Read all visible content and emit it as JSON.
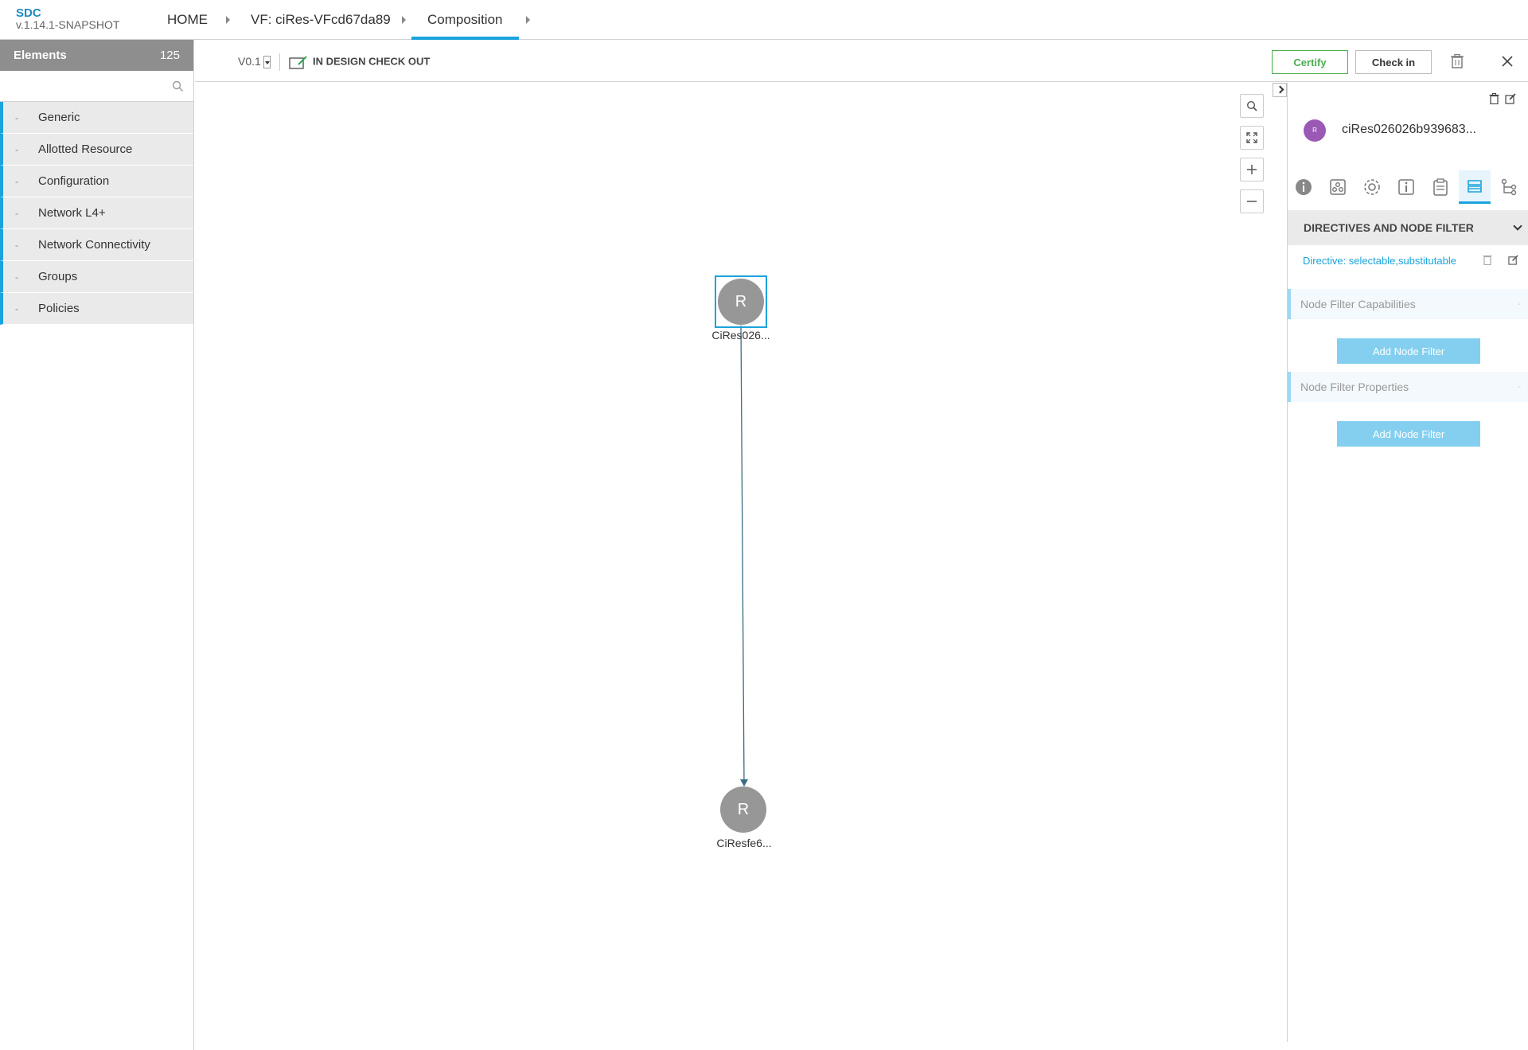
{
  "header": {
    "app_name": "SDC",
    "version": "v.1.14.1-SNAPSHOT",
    "breadcrumbs": [
      "HOME",
      "VF: ciRes-VFcd67da89",
      "Composition"
    ]
  },
  "palette": {
    "title": "Elements",
    "count": "125",
    "search_placeholder": "",
    "groups": [
      {
        "dash": "-",
        "label": "Generic"
      },
      {
        "dash": "-",
        "label": "Allotted Resource"
      },
      {
        "dash": "-",
        "label": "Configuration"
      },
      {
        "dash": "-",
        "label": "Network L4+"
      },
      {
        "dash": "-",
        "label": "Network Connectivity"
      },
      {
        "dash": "-",
        "label": "Groups"
      },
      {
        "dash": "-",
        "label": "Policies"
      }
    ]
  },
  "toolbar": {
    "version": "V0.1",
    "state": "IN DESIGN CHECK OUT",
    "certify_label": "Certify",
    "checkin_label": "Check in"
  },
  "canvas": {
    "nodes": [
      {
        "letter": "R",
        "label": "CiRes026..."
      },
      {
        "letter": "R",
        "label": "CiResfe6..."
      }
    ]
  },
  "right_panel": {
    "avatar_letter": "R",
    "component_name": "ciRes026026b939683...",
    "section_title": "DIRECTIVES AND NODE FILTER",
    "directive": "Directive: selectable,substitutable",
    "capabilities_title": "Node Filter Capabilities",
    "properties_title": "Node Filter Properties",
    "sub_dash": "-",
    "add_filter_label": "Add Node Filter"
  },
  "colors": {
    "accent": "#1aa3dc",
    "node": "#979797",
    "certify": "#4caf50",
    "avatar": "#9b59b6"
  }
}
